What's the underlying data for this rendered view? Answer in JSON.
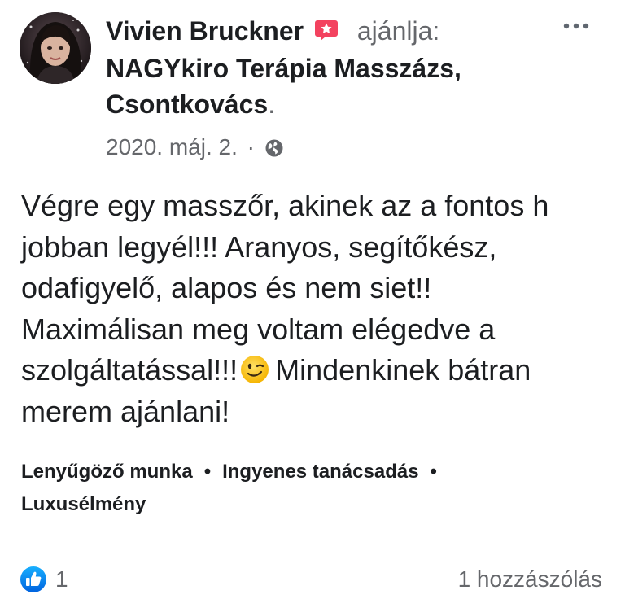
{
  "post": {
    "author": "Vivien Bruckner",
    "action": "ajánlja:",
    "page_name": "NAGYkiro Terápia Masszázs, Csontkovács",
    "page_name_line1": "NAGYkiro Terápia Masszázs,",
    "page_name_line2": "Csontkovács",
    "page_name_period": ".",
    "date": "2020. máj. 2.",
    "meta_separator": "·",
    "privacy_icon": "globe-icon",
    "badge_icon": "recommend-star-icon",
    "more_icon": "more-options-icon",
    "text_lines": [
      "Végre egy masszőr, akinek az a fontos h",
      "jobban legyél!!! Aranyos, segítőkész,",
      "odafigyelő, alapos és nem siet!!",
      "Maximálisan meg voltam elégedve a",
      "szolgáltatással!!!",
      "Mindenkinek bátran",
      "merem ajánlani!"
    ],
    "emoji": "winking-face-emoji"
  },
  "tags": {
    "items": [
      "Lenyűgöző munka",
      "Ingyenes tanácsadás",
      "Luxusélmény"
    ],
    "separator": "•"
  },
  "footer": {
    "reaction_icon": "like-icon",
    "reaction_count": "1",
    "comments": "1 hozzászólás"
  },
  "colors": {
    "text": "#1c1e21",
    "secondary_text": "#65676b",
    "like_blue": "#1877f2",
    "badge_red": "#f3425f"
  }
}
